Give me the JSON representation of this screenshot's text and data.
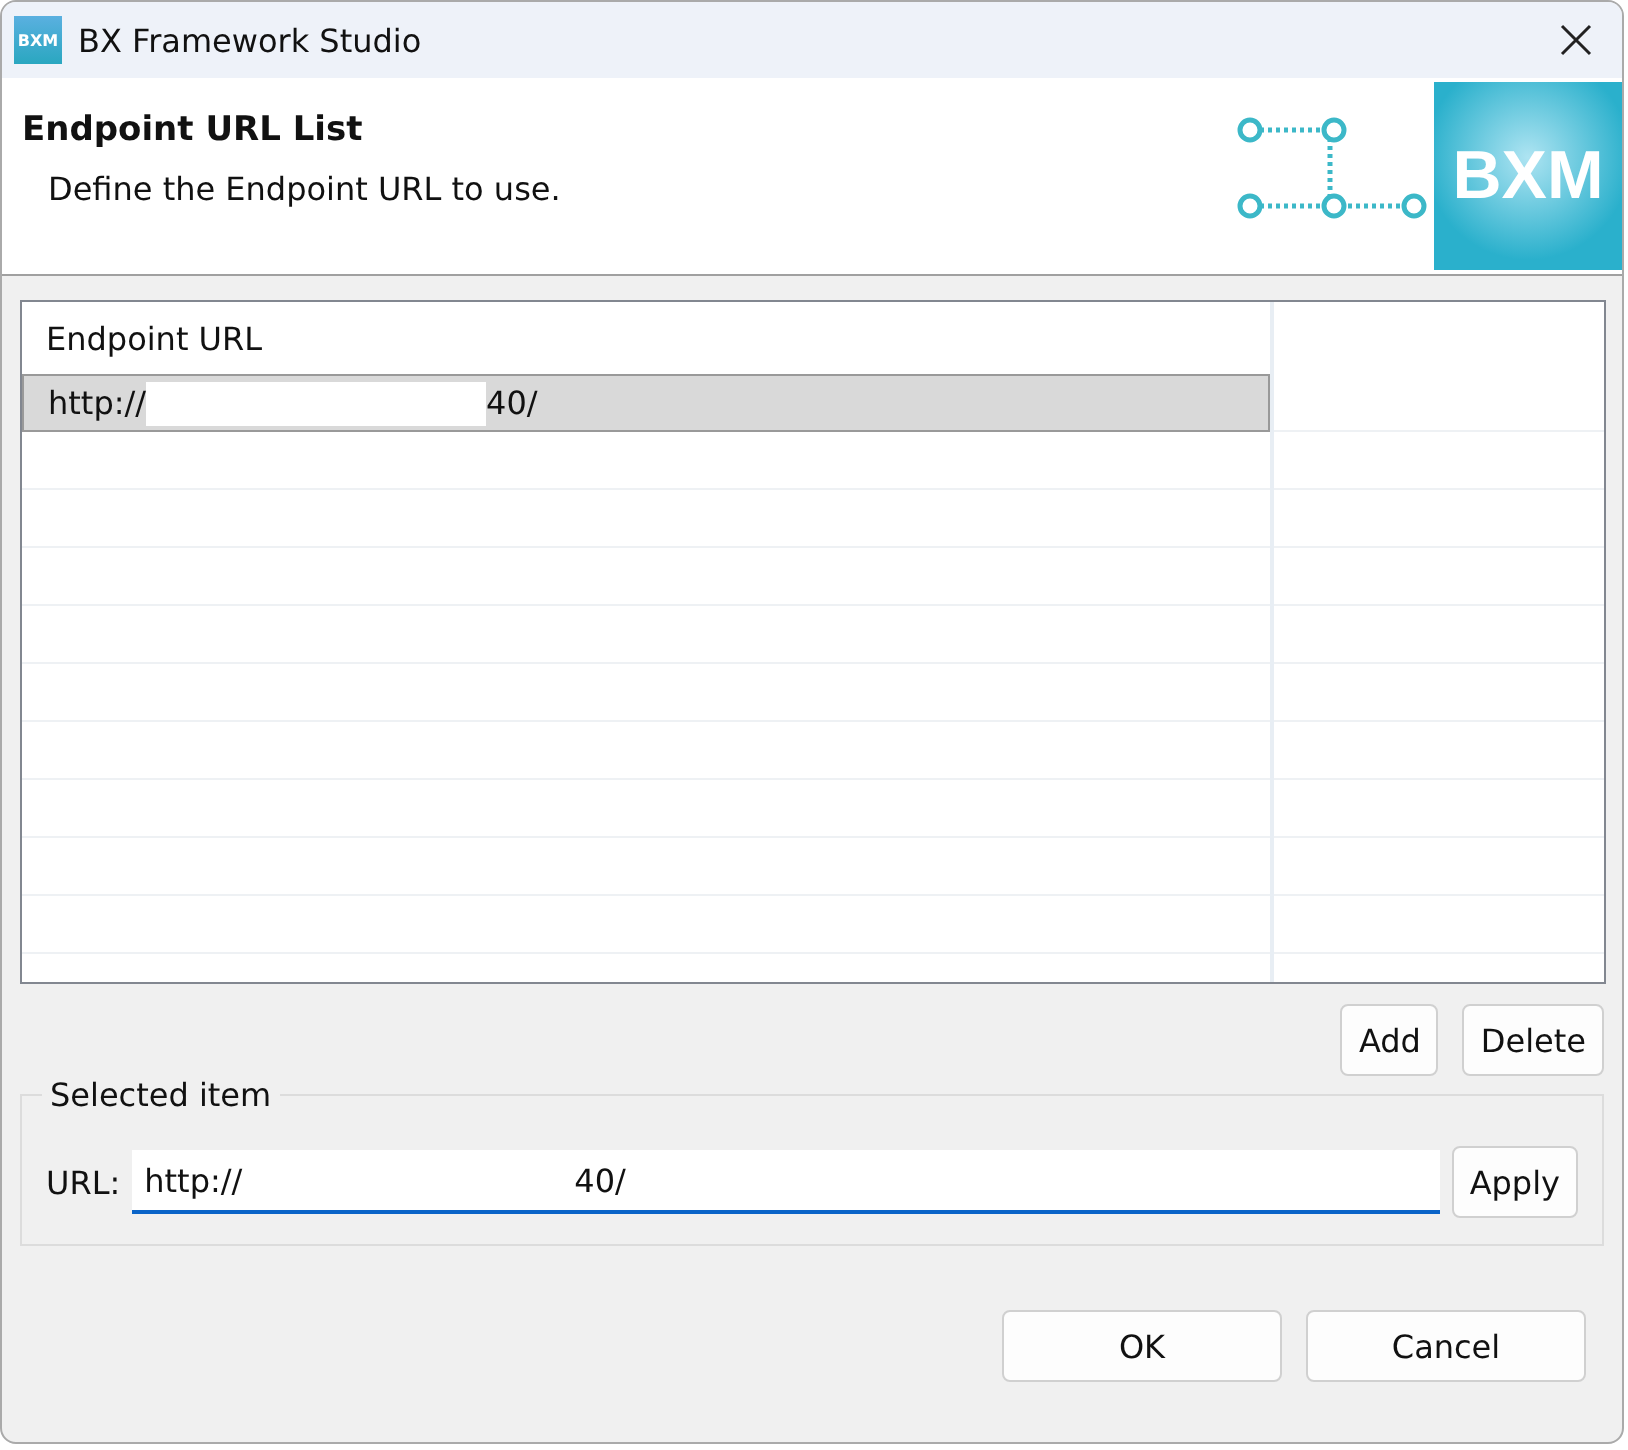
{
  "window": {
    "title": "BX Framework Studio",
    "logo": "BXM"
  },
  "header": {
    "title": "Endpoint URL List",
    "description": "Define the Endpoint URL to use.",
    "logo": "BXM"
  },
  "table": {
    "columns": [
      "Endpoint URL"
    ],
    "rows": [
      {
        "url_start": "http://",
        "url_end": "40/",
        "selected": true
      }
    ]
  },
  "list_buttons": [
    "Add",
    "Delete"
  ],
  "selected_item": {
    "legend": "Selected item",
    "label": "URL:",
    "value_start": "http://",
    "value_end": "40/",
    "apply": "Apply"
  },
  "buttons": [
    "OK",
    "Cancel"
  ]
}
